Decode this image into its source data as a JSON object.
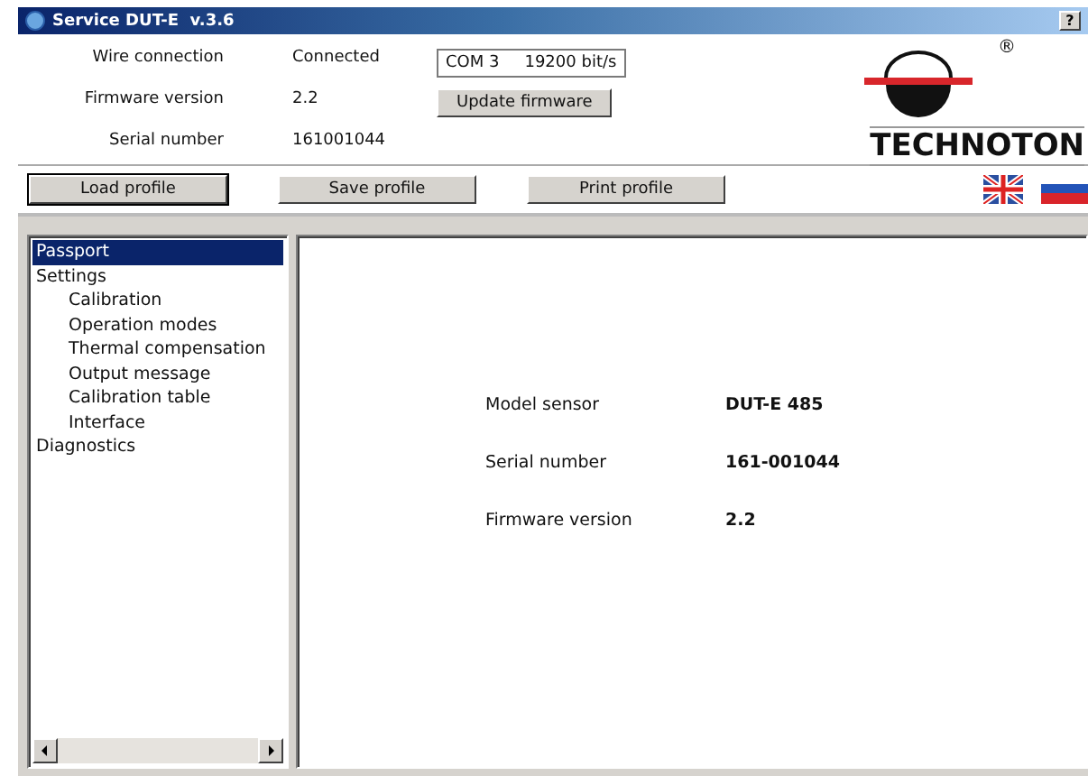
{
  "window": {
    "title": "Service DUT-E  v.3.6",
    "help": "?"
  },
  "connection": [
    {
      "label": "Wire connection",
      "value": "Connected"
    },
    {
      "label": "Firmware version",
      "value": "2.2"
    },
    {
      "label": "Serial number",
      "value": "161001044"
    }
  ],
  "port": {
    "port": "COM 3",
    "baud": "19200 bit/s"
  },
  "update_button": "Update firmware",
  "logo": {
    "name": "TECHNOTON",
    "registered": "®"
  },
  "buttons": [
    {
      "label": "Load profile",
      "selected": true
    },
    {
      "label": "Save profile",
      "selected": false
    },
    {
      "label": "Print profile",
      "selected": false
    }
  ],
  "tree": [
    {
      "label": "Passport",
      "selected": true
    },
    {
      "label": "Settings",
      "selected": false,
      "children": [
        {
          "label": "Calibration",
          "selected": false
        },
        {
          "label": "Operation modes",
          "selected": false
        },
        {
          "label": "Thermal compensation",
          "selected": false
        },
        {
          "label": "Output message",
          "selected": false
        },
        {
          "label": "Calibration table",
          "selected": false
        },
        {
          "label": "Interface",
          "selected": false
        }
      ]
    },
    {
      "label": "Diagnostics",
      "selected": false
    }
  ],
  "passport": [
    {
      "label": "Model sensor",
      "value": "DUT-E 485"
    },
    {
      "label": "Serial number",
      "value": "161-001044"
    },
    {
      "label": "Firmware version",
      "value": "2.2"
    }
  ]
}
